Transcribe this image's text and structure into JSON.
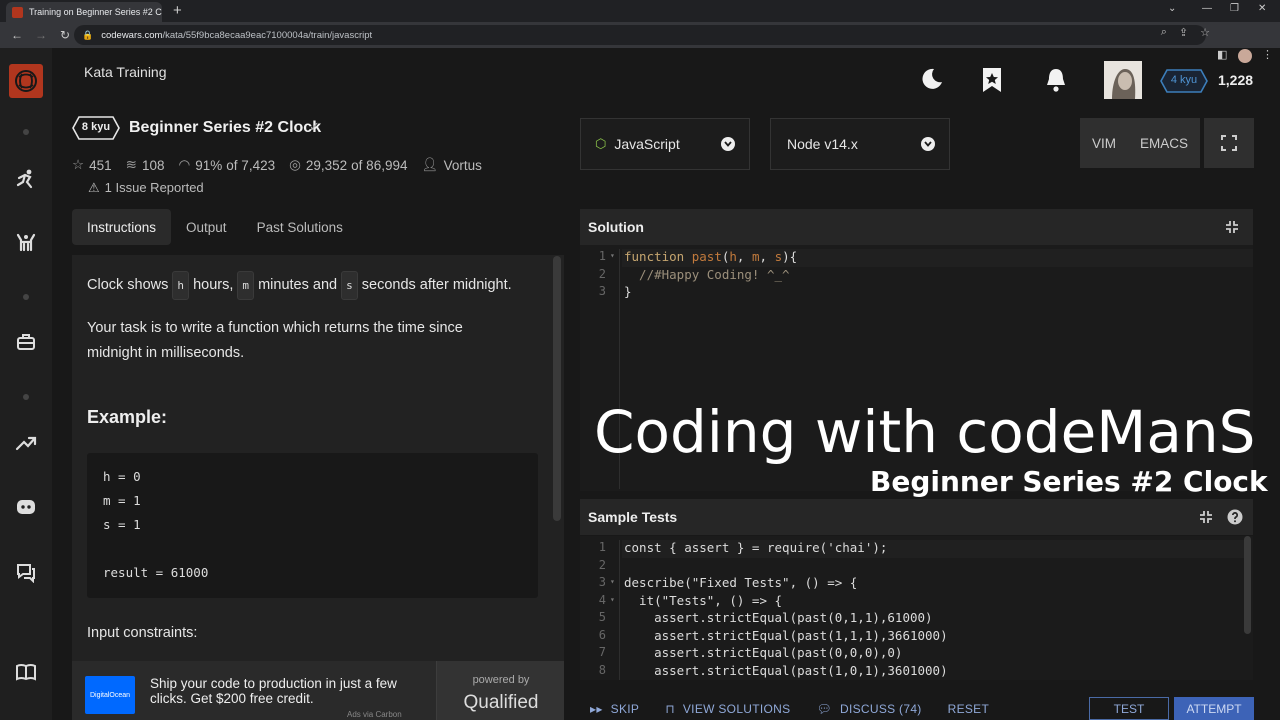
{
  "browser": {
    "tab_title": "Training on Beginner Series #2 Cl",
    "url_domain": "codewars.com",
    "url_path": "/kata/55f9bca8ecaa9eac7100004a/train/javascript"
  },
  "header": {
    "section_title": "Kata Training",
    "rank_badge": "4 kyu",
    "honor": "1,228"
  },
  "kata": {
    "kyu": "8 kyu",
    "name": "Beginner Series #2 Clock",
    "stars": "451",
    "collections": "108",
    "satisfaction": "91%",
    "satisfaction_of": "of 7,423",
    "completed": "29,352",
    "completed_of": "of 86,994",
    "author": "Vortus",
    "issues": "1 Issue Reported"
  },
  "tabs": [
    "Instructions",
    "Output",
    "Past Solutions"
  ],
  "instructions": {
    "line1_a": "Clock shows",
    "var_h": "h",
    "line1_b": "hours,",
    "var_m": "m",
    "line1_c": "minutes and",
    "var_s": "s",
    "line1_d": "seconds after midnight.",
    "para2_l1": "Your task is to write a function which returns the time since",
    "para2_l2": "midnight in milliseconds.",
    "example_heading": "Example:",
    "example_lines": [
      "h = 0",
      "m = 1",
      "s = 1",
      "",
      "result = 61000"
    ],
    "constraints_heading": "Input constraints:"
  },
  "ad": {
    "sponsor": "DigitalOcean",
    "line1": "Ship your code to production in just a few",
    "line2": "clicks. Get $200 free credit.",
    "via": "Ads via Carbon",
    "powered_by": "powered by",
    "qualified": "Qualified"
  },
  "toolbar": {
    "language": "JavaScript",
    "version": "Node v14.x",
    "vim": "VIM",
    "emacs": "EMACS"
  },
  "solution": {
    "title": "Solution",
    "line_numbers": [
      "1",
      "2",
      "3"
    ],
    "code": {
      "l1_kw": "function",
      "l1_fn": "past",
      "l1_open": "(",
      "l1_h": "h",
      "l1_c1": ", ",
      "l1_m": "m",
      "l1_c2": ", ",
      "l1_s": "s",
      "l1_close": "){",
      "l2": "  //#Happy Coding! ^_^",
      "l3": "}"
    }
  },
  "overlay": {
    "title": "Coding with codeManS",
    "subtitle": "Beginner Series #2 Clock"
  },
  "tests": {
    "title": "Sample Tests",
    "line_numbers": [
      "1",
      "2",
      "3",
      "4",
      "5",
      "6",
      "7",
      "8"
    ],
    "lines": [
      "const { assert } = require('chai');",
      "",
      "describe(\"Fixed Tests\", () => {",
      "  it(\"Tests\", () => {",
      "    assert.strictEqual(past(0,1,1),61000)",
      "    assert.strictEqual(past(1,1,1),3661000)",
      "    assert.strictEqual(past(0,0,0),0)",
      "    assert.strictEqual(past(1,0,1),3601000)"
    ]
  },
  "bottom": {
    "skip": "SKIP",
    "view_solutions": "VIEW SOLUTIONS",
    "discuss": "DISCUSS (74)",
    "reset": "RESET",
    "test": "TEST",
    "attempt": "ATTEMPT"
  },
  "colors": {
    "brand": "#b1361e",
    "accent_blue": "#3d63b7",
    "rank_blue": "#3c7ebb"
  }
}
